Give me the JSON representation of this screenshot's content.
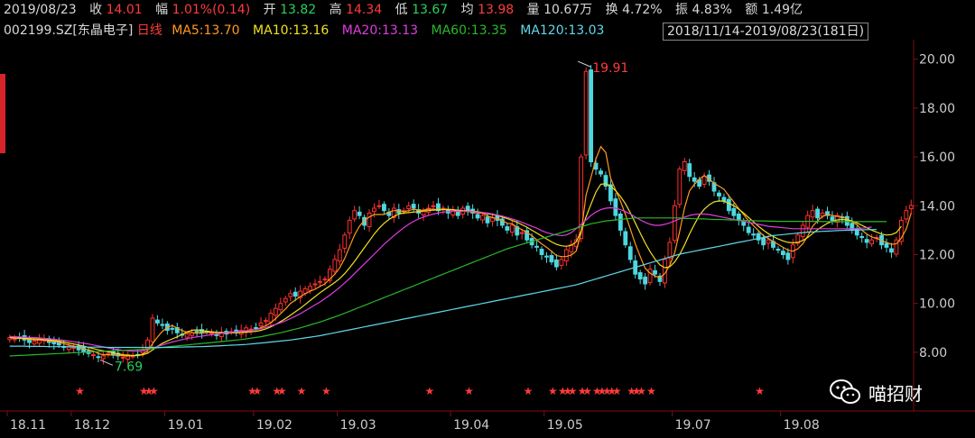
{
  "quote": {
    "date": "2019/08/23",
    "close_label": "收",
    "close": "14.01",
    "change_label": "幅",
    "change": "1.01%(0.14)",
    "open_label": "开",
    "open": "13.82",
    "high_label": "高",
    "high": "14.34",
    "low_label": "低",
    "low": "13.67",
    "avg_label": "均",
    "avg": "13.98",
    "vol_label": "量",
    "vol": "10.67万",
    "turnover_label": "换",
    "turnover": "4.72%",
    "amplitude_label": "振",
    "amplitude": "4.83%",
    "amount_label": "额",
    "amount": "1.49亿"
  },
  "header": {
    "symbol": "002199.SZ",
    "name": "[东晶电子]",
    "period": "日线",
    "range": "2018/11/14-2019/08/23(181日)"
  },
  "ma": [
    {
      "label": "MA5:13.70",
      "color": "#ff9a1f"
    },
    {
      "label": "MA10:13.16",
      "color": "#f0e020"
    },
    {
      "label": "MA20:13.13",
      "color": "#e03ce0"
    },
    {
      "label": "MA60:13.35",
      "color": "#2ab82a"
    },
    {
      "label": "MA120:13.03",
      "color": "#5fd8e8"
    }
  ],
  "colors": {
    "up": "#ff3030",
    "down": "#4cd8e0",
    "axis": "#7a1010"
  },
  "watermark": {
    "text": "喵招财",
    "icon": "wechat-icon"
  },
  "chart_data": {
    "type": "candlestick",
    "ylim": [
      7.0,
      20.8
    ],
    "yticks": [
      "20.00",
      "18.00",
      "16.00",
      "14.00",
      "12.00",
      "10.00",
      "8.00"
    ],
    "ytick_values": [
      20,
      18,
      16,
      14,
      12,
      10,
      8
    ],
    "xticks": [
      "18.11",
      "18.12",
      "19.01",
      "19.02",
      "19.03",
      "19.04",
      "19.05",
      "19.07",
      "19.08"
    ],
    "xtick_index": [
      0,
      13,
      32,
      50,
      67,
      90,
      109,
      135,
      157
    ],
    "annotations": [
      {
        "text": "19.91",
        "index": 115,
        "value": 19.91,
        "color": "#ff3b3b"
      },
      {
        "text": "7.69",
        "index": 18,
        "value": 7.69,
        "color": "#2ad15a"
      }
    ],
    "star_index": [
      14,
      27,
      28,
      29,
      49,
      50,
      54,
      55,
      59,
      64,
      85,
      93,
      105,
      110,
      112,
      113,
      114,
      116,
      117,
      119,
      120,
      121,
      122,
      123,
      126,
      127,
      128,
      130,
      152
    ],
    "closes": [
      8.6,
      8.55,
      8.6,
      8.5,
      8.4,
      8.45,
      8.55,
      8.5,
      8.4,
      8.35,
      8.3,
      8.2,
      8.25,
      8.2,
      8.1,
      8.0,
      7.95,
      7.9,
      7.8,
      7.85,
      7.95,
      7.9,
      7.85,
      7.8,
      7.9,
      7.85,
      7.9,
      8.1,
      8.5,
      9.4,
      9.2,
      9.1,
      8.9,
      8.95,
      8.8,
      8.7,
      8.75,
      8.8,
      8.85,
      8.8,
      8.85,
      8.8,
      8.7,
      8.8,
      8.75,
      8.85,
      8.8,
      8.9,
      9.0,
      8.95,
      9.0,
      9.2,
      9.3,
      9.6,
      9.8,
      10.0,
      10.2,
      10.4,
      10.3,
      10.5,
      10.6,
      10.7,
      10.8,
      10.9,
      11.0,
      11.4,
      11.8,
      12.2,
      12.8,
      13.4,
      13.8,
      13.6,
      13.2,
      13.7,
      13.9,
      14.0,
      13.8,
      13.6,
      13.9,
      13.7,
      13.8,
      14.0,
      13.9,
      13.7,
      13.8,
      13.9,
      14.0,
      13.8,
      13.9,
      13.7,
      13.8,
      13.6,
      13.9,
      13.8,
      13.7,
      13.5,
      13.6,
      13.3,
      13.5,
      13.4,
      13.2,
      13.0,
      13.2,
      12.8,
      12.9,
      12.6,
      12.4,
      12.3,
      12.0,
      11.9,
      11.7,
      11.5,
      11.8,
      12.2,
      12.4,
      12.6,
      16.0,
      19.5,
      15.8,
      15.5,
      15.3,
      14.8,
      14.2,
      13.6,
      13.0,
      12.4,
      11.8,
      11.2,
      11.0,
      10.8,
      11.4,
      11.2,
      10.9,
      11.8,
      12.5,
      14.0,
      15.5,
      15.8,
      15.2,
      15.0,
      14.8,
      15.2,
      15.0,
      14.6,
      14.4,
      14.2,
      13.8,
      13.6,
      13.4,
      13.2,
      12.9,
      12.8,
      12.6,
      12.4,
      12.6,
      12.3,
      12.2,
      12.0,
      11.8,
      12.4,
      12.8,
      13.2,
      13.6,
      13.8,
      13.5,
      13.7,
      13.6,
      13.4,
      13.6,
      13.5,
      13.2,
      13.0,
      12.8,
      12.7,
      12.5,
      12.6,
      12.7,
      12.4,
      12.3,
      12.1,
      12.6,
      13.4,
      13.8,
      14.01
    ],
    "ma5": [
      8.6,
      8.58,
      8.57,
      8.55,
      8.53,
      8.5,
      8.5,
      8.5,
      8.46,
      8.45,
      8.42,
      8.35,
      8.3,
      8.26,
      8.2,
      8.15,
      8.1,
      8.05,
      7.95,
      7.9,
      7.9,
      7.88,
      7.88,
      7.86,
      7.85,
      7.86,
      7.86,
      7.93,
      8.05,
      8.35,
      8.62,
      8.86,
      9.02,
      9.1,
      8.99,
      8.89,
      8.82,
      8.8,
      8.78,
      8.78,
      8.81,
      8.82,
      8.8,
      8.8,
      8.78,
      8.8,
      8.8,
      8.82,
      8.86,
      8.9,
      8.93,
      9.01,
      9.09,
      9.21,
      9.38,
      9.58,
      9.78,
      10.0,
      10.14,
      10.28,
      10.4,
      10.5,
      10.58,
      10.7,
      10.8,
      11.0,
      11.2,
      11.46,
      11.84,
      12.32,
      12.8,
      13.16,
      13.4,
      13.54,
      13.64,
      13.64,
      13.64,
      13.74,
      13.8,
      13.8,
      13.76,
      13.8,
      13.86,
      13.82,
      13.82,
      13.86,
      13.86,
      13.84,
      13.86,
      13.86,
      13.84,
      13.76,
      13.78,
      13.76,
      13.74,
      13.7,
      13.7,
      13.58,
      13.52,
      13.46,
      13.4,
      13.28,
      13.26,
      13.12,
      13.02,
      12.9,
      12.78,
      12.6,
      12.44,
      12.3,
      12.14,
      11.96,
      11.92,
      11.92,
      11.98,
      12.14,
      12.88,
      14.42,
      15.16,
      15.92,
      16.42,
      16.18,
      15.12,
      14.64,
      14.18,
      13.64,
      13.04,
      12.44,
      11.92,
      11.44,
      11.24,
      11.12,
      11.06,
      11.22,
      11.56,
      12.08,
      12.94,
      13.92,
      14.6,
      14.88,
      15.08,
      15.24,
      15.1,
      14.92,
      14.8,
      14.68,
      14.4,
      14.16,
      13.88,
      13.64,
      13.38,
      13.18,
      12.98,
      12.78,
      12.66,
      12.54,
      12.42,
      12.3,
      12.18,
      12.14,
      12.24,
      12.44,
      12.76,
      13.16,
      13.38,
      13.56,
      13.64,
      13.6,
      13.56,
      13.56,
      13.46,
      13.34,
      13.22,
      13.0,
      12.84,
      12.72,
      12.66,
      12.58,
      12.5,
      12.42,
      12.44,
      12.68,
      13.04,
      13.7
    ],
    "ma10": [
      8.6,
      8.59,
      8.58,
      8.57,
      8.56,
      8.55,
      8.54,
      8.52,
      8.5,
      8.48,
      8.46,
      8.42,
      8.38,
      8.34,
      8.3,
      8.25,
      8.2,
      8.15,
      8.1,
      8.06,
      8.02,
      7.98,
      7.94,
      7.9,
      7.88,
      7.87,
      7.87,
      7.9,
      7.96,
      8.1,
      8.24,
      8.37,
      8.46,
      8.55,
      8.63,
      8.73,
      8.83,
      8.9,
      8.92,
      8.9,
      8.86,
      8.84,
      8.82,
      8.81,
      8.8,
      8.8,
      8.8,
      8.81,
      8.82,
      8.84,
      8.86,
      8.9,
      8.96,
      9.04,
      9.14,
      9.26,
      9.38,
      9.52,
      9.66,
      9.8,
      9.96,
      10.12,
      10.28,
      10.44,
      10.58,
      10.72,
      10.86,
      11.02,
      11.22,
      11.46,
      11.72,
      12.0,
      12.28,
      12.56,
      12.84,
      13.08,
      13.28,
      13.44,
      13.56,
      13.66,
      13.7,
      13.72,
      13.74,
      13.76,
      13.78,
      13.8,
      13.82,
      13.83,
      13.84,
      13.84,
      13.84,
      13.82,
      13.8,
      13.79,
      13.78,
      13.76,
      13.72,
      13.68,
      13.64,
      13.6,
      13.54,
      13.48,
      13.4,
      13.32,
      13.22,
      13.12,
      13.0,
      12.88,
      12.76,
      12.64,
      12.52,
      12.42,
      12.36,
      12.34,
      12.38,
      12.52,
      12.96,
      13.54,
      14.06,
      14.56,
      14.88,
      14.9,
      14.8,
      14.62,
      14.38,
      14.08,
      13.7,
      13.3,
      12.88,
      12.48,
      12.12,
      11.82,
      11.58,
      11.46,
      11.5,
      11.7,
      12.0,
      12.4,
      12.84,
      13.24,
      13.6,
      13.86,
      14.04,
      14.16,
      14.2,
      14.18,
      14.1,
      14.0,
      13.86,
      13.7,
      13.52,
      13.34,
      13.16,
      13.0,
      12.86,
      12.74,
      12.64,
      12.56,
      12.5,
      12.48,
      12.5,
      12.58,
      12.7,
      12.86,
      13.02,
      13.16,
      13.28,
      13.36,
      13.42,
      13.44,
      13.42,
      13.38,
      13.3,
      13.2,
      13.1,
      13.0,
      12.92,
      12.84,
      12.8,
      12.82,
      12.9,
      13.16
    ],
    "ma20": [
      8.65,
      8.64,
      8.63,
      8.62,
      8.61,
      8.6,
      8.59,
      8.57,
      8.55,
      8.53,
      8.51,
      8.49,
      8.46,
      8.43,
      8.4,
      8.37,
      8.34,
      8.3,
      8.26,
      8.22,
      8.18,
      8.14,
      8.11,
      8.08,
      8.06,
      8.05,
      8.05,
      8.06,
      8.1,
      8.16,
      8.24,
      8.3,
      8.36,
      8.42,
      8.47,
      8.52,
      8.56,
      8.6,
      8.63,
      8.66,
      8.69,
      8.72,
      8.75,
      8.78,
      8.8,
      8.82,
      8.84,
      8.86,
      8.88,
      8.9,
      8.93,
      8.97,
      9.02,
      9.08,
      9.14,
      9.21,
      9.29,
      9.38,
      9.48,
      9.58,
      9.7,
      9.82,
      9.94,
      10.06,
      10.2,
      10.34,
      10.5,
      10.66,
      10.84,
      11.02,
      11.22,
      11.42,
      11.62,
      11.82,
      12.02,
      12.22,
      12.42,
      12.6,
      12.78,
      12.94,
      13.1,
      13.24,
      13.36,
      13.46,
      13.54,
      13.6,
      13.66,
      13.7,
      13.74,
      13.76,
      13.78,
      13.78,
      13.78,
      13.77,
      13.76,
      13.74,
      13.72,
      13.7,
      13.66,
      13.62,
      13.58,
      13.52,
      13.46,
      13.4,
      13.32,
      13.24,
      13.16,
      13.08,
      12.98,
      12.9,
      12.84,
      12.8,
      12.78,
      12.8,
      12.9,
      13.06,
      13.24,
      13.42,
      13.6,
      13.74,
      13.84,
      13.9,
      13.92,
      13.9,
      13.84,
      13.76,
      13.66,
      13.54,
      13.42,
      13.32,
      13.24,
      13.2,
      13.2,
      13.24,
      13.3,
      13.38,
      13.46,
      13.54,
      13.6,
      13.64,
      13.66,
      13.66,
      13.64,
      13.6,
      13.56,
      13.52,
      13.48,
      13.44,
      13.4,
      13.36,
      13.32,
      13.28,
      13.24,
      13.2,
      13.16,
      13.14,
      13.12,
      13.1,
      13.08,
      13.06,
      13.06,
      13.06,
      13.06,
      13.06,
      13.06,
      13.06,
      13.06,
      13.06,
      13.06,
      13.06,
      13.06,
      13.06,
      13.06,
      13.08,
      13.1,
      13.13
    ],
    "ma60": [
      7.85,
      7.86,
      7.87,
      7.88,
      7.89,
      7.9,
      7.91,
      7.92,
      7.93,
      7.94,
      7.95,
      7.96,
      7.97,
      7.98,
      7.99,
      8.0,
      8.01,
      8.02,
      8.03,
      8.04,
      8.05,
      8.06,
      8.07,
      8.08,
      8.09,
      8.1,
      8.11,
      8.12,
      8.14,
      8.16,
      8.18,
      8.2,
      8.22,
      8.24,
      8.26,
      8.28,
      8.3,
      8.32,
      8.34,
      8.36,
      8.38,
      8.4,
      8.42,
      8.44,
      8.46,
      8.48,
      8.5,
      8.52,
      8.55,
      8.58,
      8.61,
      8.64,
      8.68,
      8.72,
      8.76,
      8.8,
      8.85,
      8.9,
      8.95,
      9.0,
      9.06,
      9.12,
      9.18,
      9.24,
      9.31,
      9.38,
      9.45,
      9.52,
      9.6,
      9.68,
      9.76,
      9.84,
      9.92,
      10.0,
      10.08,
      10.16,
      10.24,
      10.32,
      10.4,
      10.48,
      10.56,
      10.64,
      10.72,
      10.8,
      10.88,
      10.96,
      11.04,
      11.12,
      11.2,
      11.28,
      11.36,
      11.44,
      11.52,
      11.6,
      11.68,
      11.76,
      11.84,
      11.92,
      12.0,
      12.08,
      12.16,
      12.24,
      12.3,
      12.36,
      12.42,
      12.48,
      12.54,
      12.6,
      12.66,
      12.72,
      12.78,
      12.84,
      12.9,
      12.96,
      13.02,
      13.08,
      13.14,
      13.2,
      13.26,
      13.3,
      13.34,
      13.38,
      13.4,
      13.42,
      13.44,
      13.46,
      13.48,
      13.5,
      13.5,
      13.5,
      13.5,
      13.5,
      13.5,
      13.5,
      13.5,
      13.5,
      13.5,
      13.48,
      13.48,
      13.47,
      13.46,
      13.46,
      13.45,
      13.44,
      13.44,
      13.43,
      13.42,
      13.42,
      13.41,
      13.4,
      13.4,
      13.39,
      13.38,
      13.38,
      13.37,
      13.37,
      13.36,
      13.36,
      13.36,
      13.36,
      13.36,
      13.36,
      13.36,
      13.36,
      13.36,
      13.35,
      13.35,
      13.35,
      13.35,
      13.35,
      13.35,
      13.35,
      13.35,
      13.35,
      13.35,
      13.35,
      13.35,
      13.35,
      13.35
    ],
    "ma120": [
      8.25,
      8.25,
      8.25,
      8.25,
      8.24,
      8.24,
      8.24,
      8.24,
      8.23,
      8.23,
      8.23,
      8.23,
      8.22,
      8.22,
      8.22,
      8.22,
      8.21,
      8.21,
      8.21,
      8.21,
      8.2,
      8.2,
      8.2,
      8.2,
      8.2,
      8.2,
      8.2,
      8.2,
      8.2,
      8.2,
      8.2,
      8.2,
      8.2,
      8.2,
      8.21,
      8.21,
      8.22,
      8.22,
      8.23,
      8.23,
      8.24,
      8.25,
      8.26,
      8.27,
      8.28,
      8.29,
      8.3,
      8.31,
      8.32,
      8.34,
      8.36,
      8.38,
      8.4,
      8.42,
      8.44,
      8.46,
      8.48,
      8.5,
      8.53,
      8.56,
      8.59,
      8.62,
      8.65,
      8.68,
      8.72,
      8.76,
      8.8,
      8.84,
      8.88,
      8.92,
      8.96,
      9.0,
      9.04,
      9.08,
      9.12,
      9.16,
      9.2,
      9.24,
      9.28,
      9.32,
      9.36,
      9.4,
      9.44,
      9.48,
      9.52,
      9.56,
      9.6,
      9.64,
      9.68,
      9.72,
      9.76,
      9.8,
      9.84,
      9.88,
      9.92,
      9.96,
      10.0,
      10.04,
      10.08,
      10.12,
      10.16,
      10.2,
      10.24,
      10.28,
      10.32,
      10.36,
      10.4,
      10.44,
      10.48,
      10.52,
      10.56,
      10.6,
      10.64,
      10.68,
      10.72,
      10.76,
      10.82,
      10.88,
      10.94,
      11.0,
      11.06,
      11.12,
      11.18,
      11.24,
      11.3,
      11.36,
      11.42,
      11.48,
      11.54,
      11.6,
      11.66,
      11.72,
      11.78,
      11.84,
      11.9,
      11.96,
      12.02,
      12.06,
      12.1,
      12.14,
      12.18,
      12.22,
      12.26,
      12.3,
      12.34,
      12.38,
      12.42,
      12.46,
      12.5,
      12.54,
      12.58,
      12.62,
      12.66,
      12.7,
      12.74,
      12.78,
      12.8,
      12.82,
      12.84,
      12.86,
      12.88,
      12.9,
      12.92,
      12.93,
      12.94,
      12.95,
      12.96,
      12.97,
      12.98,
      12.99,
      13.0,
      13.0,
      13.01,
      13.01,
      13.02,
      13.02,
      13.03
    ]
  }
}
